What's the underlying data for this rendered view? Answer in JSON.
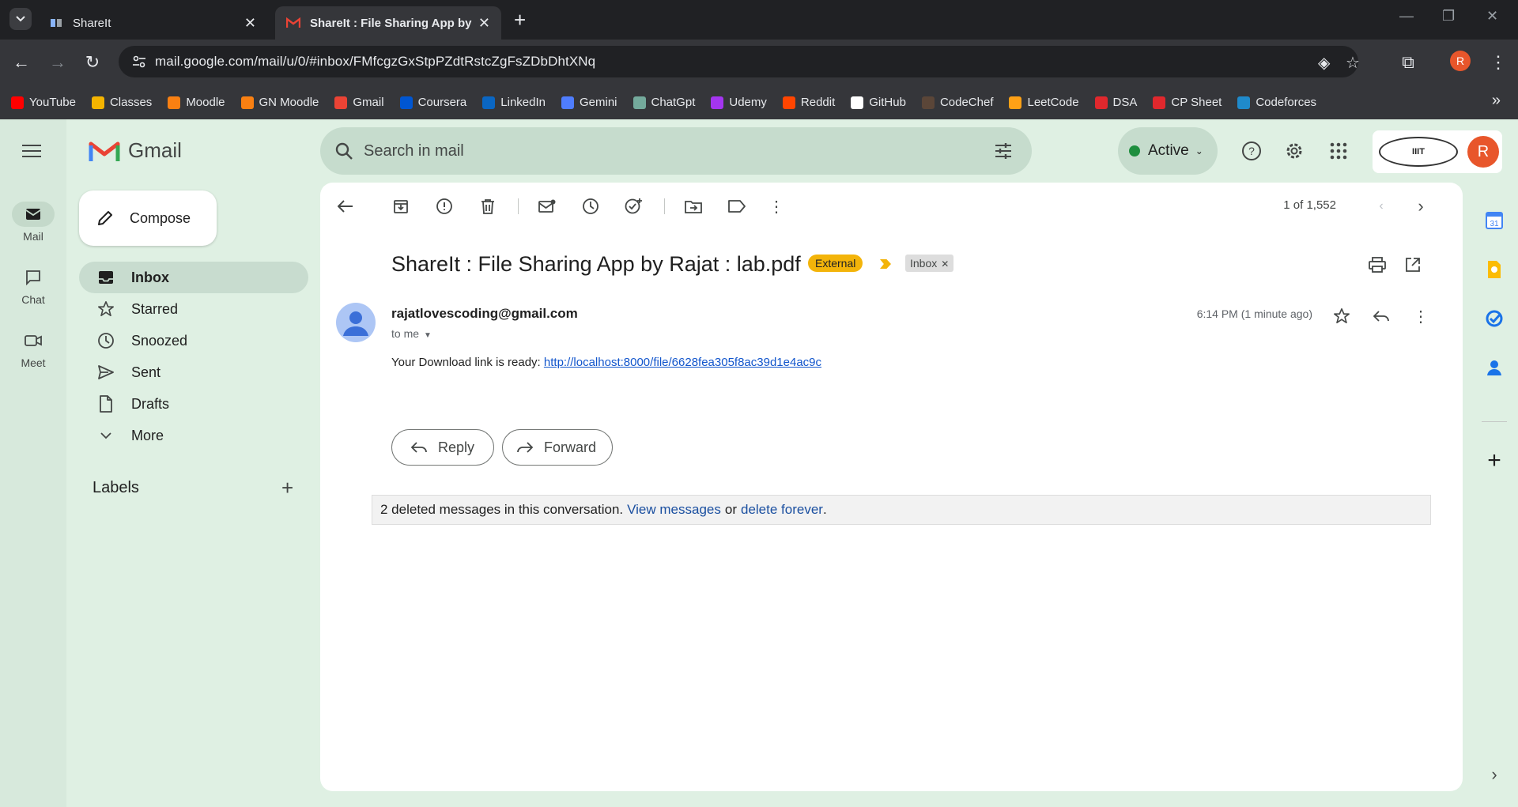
{
  "browser": {
    "tabs": [
      {
        "title": "ShareIt",
        "active": false
      },
      {
        "title": "ShareIt : File Sharing App by Rajat : lab.pdf",
        "active": true
      }
    ],
    "url": "mail.google.com/mail/u/0/#inbox/FMfcgzGxStpPZdtRstcZgFsZDbDhtXNq",
    "profile_initial": "R",
    "bookmarks": [
      {
        "label": "YouTube",
        "color": "#ff0000"
      },
      {
        "label": "Classes",
        "color": "#f4b400"
      },
      {
        "label": "Moodle",
        "color": "#f98012"
      },
      {
        "label": "GN Moodle",
        "color": "#f98012"
      },
      {
        "label": "Gmail",
        "color": "#ea4335"
      },
      {
        "label": "Coursera",
        "color": "#0056d2"
      },
      {
        "label": "LinkedIn",
        "color": "#0a66c2"
      },
      {
        "label": "Gemini",
        "color": "#4f7dfd"
      },
      {
        "label": "ChatGpt",
        "color": "#74aa9c"
      },
      {
        "label": "Udemy",
        "color": "#a435f0"
      },
      {
        "label": "Reddit",
        "color": "#ff4500"
      },
      {
        "label": "GitHub",
        "color": "#ffffff"
      },
      {
        "label": "CodeChef",
        "color": "#5b4638"
      },
      {
        "label": "LeetCode",
        "color": "#ffa116"
      },
      {
        "label": "DSA",
        "color": "#e0282d"
      },
      {
        "label": "CP Sheet",
        "color": "#e0282d"
      },
      {
        "label": "Codeforces",
        "color": "#1f8acb"
      }
    ]
  },
  "gmail": {
    "app_name": "Gmail",
    "rail": [
      {
        "label": "Mail",
        "icon": "mail-icon"
      },
      {
        "label": "Chat",
        "icon": "chat-icon"
      },
      {
        "label": "Meet",
        "icon": "meet-icon"
      }
    ],
    "search_placeholder": "Search in mail",
    "status": "Active",
    "account_initial": "R",
    "org_logo_text": "IIIT",
    "compose_label": "Compose",
    "nav": [
      {
        "label": "Inbox",
        "icon": "inbox-icon",
        "selected": true
      },
      {
        "label": "Starred",
        "icon": "star-icon"
      },
      {
        "label": "Snoozed",
        "icon": "clock-icon"
      },
      {
        "label": "Sent",
        "icon": "send-icon"
      },
      {
        "label": "Drafts",
        "icon": "draft-icon"
      },
      {
        "label": "More",
        "icon": "chevron-down-icon"
      }
    ],
    "labels_heading": "Labels",
    "pager": "1 of 1,552",
    "email": {
      "subject": "ShareIt : File Sharing App by Rajat : lab.pdf",
      "external_badge": "External",
      "inbox_badge": "Inbox",
      "sender": "rajatlovescoding@gmail.com",
      "to": "to me",
      "time": "6:14 PM (1 minute ago)",
      "body_text": "Your Download link is ready: ",
      "link": "http://localhost:8000/file/6628fea305f8ac39d1e4ac9c",
      "reply_label": "Reply",
      "forward_label": "Forward",
      "deleted_notice": {
        "prefix": "2 deleted messages in this conversation.",
        "view": "View messages",
        "or": "or",
        "delete": "delete forever",
        "suffix": "."
      }
    },
    "calendar_day": "31"
  }
}
